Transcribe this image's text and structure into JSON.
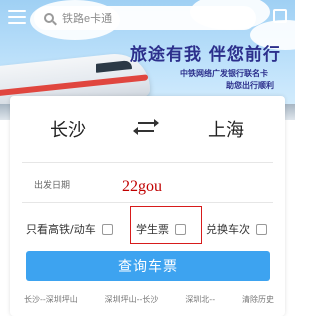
{
  "header": {
    "search_placeholder": "铁路e卡通",
    "slogan": "旅途有我 伴您前行",
    "sub_line_1": "中铁网络广发银行联名卡",
    "sub_line_2": "助您出行顺利"
  },
  "form": {
    "from_city": "长沙",
    "to_city": "上海",
    "date_label": "出发日期",
    "watermark": "22gou",
    "options": [
      {
        "label": "只看高铁/动车",
        "checked": false
      },
      {
        "label": "学生票",
        "checked": false
      },
      {
        "label": "兑换车次",
        "checked": false
      }
    ],
    "search_button": "查询车票"
  },
  "history": [
    "长沙--深圳坪山",
    "深圳坪山--长沙",
    "深圳北--",
    "清除历史"
  ],
  "colors": {
    "accent": "#3da3f0",
    "slogan": "#2c2f8c",
    "highlight": "#d71b1b"
  }
}
